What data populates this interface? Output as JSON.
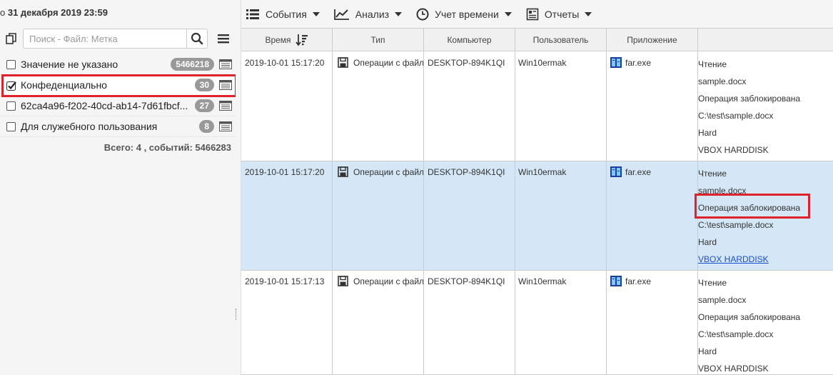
{
  "header": {
    "date_prefix": "о",
    "date_value": "31 декабря 2019 23:59"
  },
  "search": {
    "placeholder": "Поиск - Файл: Метка"
  },
  "tags": [
    {
      "label": "Значение не указано",
      "count": "5466218",
      "checked": false
    },
    {
      "label": "Конфеденциально",
      "count": "30",
      "checked": true
    },
    {
      "label": "62ca4a96-f202-40cd-ab14-7d61fbcf...",
      "count": "27",
      "checked": false
    },
    {
      "label": "Для служебного пользования",
      "count": "8",
      "checked": false
    }
  ],
  "total": "Всего: 4 , событий: 5466283",
  "toolbar": {
    "events": "События",
    "analysis": "Анализ",
    "time": "Учет времени",
    "reports": "Отчеты"
  },
  "columns": {
    "time": "Время",
    "type": "Тип",
    "computer": "Компьютер",
    "user": "Пользователь",
    "app": "Приложение"
  },
  "rows": [
    {
      "time": "2019-10-01 15:17:20",
      "type": "Операции с файл",
      "computer": "DESKTOP-894K1QI",
      "user": "Win10ermak",
      "app": "far.exe",
      "details": [
        "Чтение",
        "sample.docx",
        "Операция заблокирована",
        "C:\\test\\sample.docx",
        "Hard",
        "VBOX HARDDISK"
      ]
    },
    {
      "time": "2019-10-01 15:17:20",
      "type": "Операции с файл",
      "computer": "DESKTOP-894K1QI",
      "user": "Win10ermak",
      "app": "far.exe",
      "details": [
        "Чтение",
        "sample.docx",
        "Операция заблокирована",
        "C:\\test\\sample.docx",
        "Hard",
        "VBOX HARDDISK"
      ]
    },
    {
      "time": "2019-10-01 15:17:13",
      "type": "Операции с файл",
      "computer": "DESKTOP-894K1QI",
      "user": "Win10ermak",
      "app": "far.exe",
      "details": [
        "Чтение",
        "sample.docx",
        "Операция заблокирована",
        "C:\\test\\sample.docx",
        "Hard",
        "VBOX HARDDISK"
      ]
    }
  ],
  "colors": {
    "highlight": "#e0212c",
    "active_row": "#d5e7f6",
    "badge": "#999999",
    "link": "#1a4fd0"
  }
}
